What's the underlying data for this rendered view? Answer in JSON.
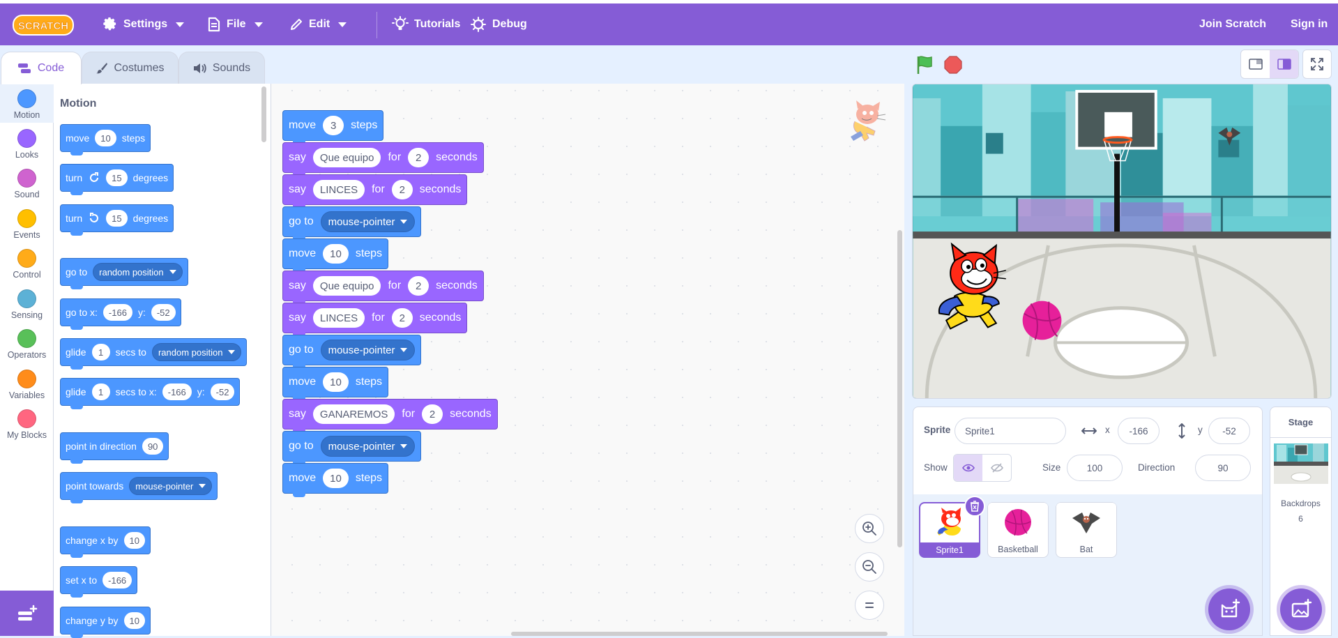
{
  "menubar": {
    "logo_text": "SCRATCH",
    "settings": "Settings",
    "file": "File",
    "edit": "Edit",
    "tutorials": "Tutorials",
    "debug": "Debug",
    "join": "Join Scratch",
    "signin": "Sign in"
  },
  "tabs": {
    "code": "Code",
    "costumes": "Costumes",
    "sounds": "Sounds"
  },
  "categories": [
    {
      "label": "Motion",
      "color": "#4c97ff"
    },
    {
      "label": "Looks",
      "color": "#9966ff"
    },
    {
      "label": "Sound",
      "color": "#cf63cf"
    },
    {
      "label": "Events",
      "color": "#ffbf00"
    },
    {
      "label": "Control",
      "color": "#ffab19"
    },
    {
      "label": "Sensing",
      "color": "#5cb1d6"
    },
    {
      "label": "Operators",
      "color": "#59c059"
    },
    {
      "label": "Variables",
      "color": "#ff8c1a"
    },
    {
      "label": "My Blocks",
      "color": "#ff6680"
    }
  ],
  "palette": {
    "title": "Motion",
    "b1": {
      "a": "move",
      "v": "10",
      "b": "steps"
    },
    "b2": {
      "a": "turn",
      "v": "15",
      "b": "degrees"
    },
    "b3": {
      "a": "turn",
      "v": "15",
      "b": "degrees"
    },
    "b4": {
      "a": "go to",
      "d": "random position"
    },
    "b5": {
      "a": "go to x:",
      "x": "-166",
      "b": "y:",
      "y": "-52"
    },
    "b6": {
      "a": "glide",
      "v": "1",
      "b": "secs to",
      "d": "random position"
    },
    "b7": {
      "a": "glide",
      "v": "1",
      "b": "secs to x:",
      "x": "-166",
      "c": "y:",
      "y": "-52"
    },
    "b8": {
      "a": "point in direction",
      "v": "90"
    },
    "b9": {
      "a": "point towards",
      "d": "mouse-pointer"
    },
    "b10": {
      "a": "change x by",
      "v": "10"
    },
    "b11": {
      "a": "set x to",
      "v": "-166"
    },
    "b12": {
      "a": "change y by",
      "v": "10"
    }
  },
  "script": [
    {
      "type": "move",
      "a": "move",
      "v": "3",
      "b": "steps"
    },
    {
      "type": "say",
      "a": "say",
      "t": "Que equipo",
      "b": "for",
      "v": "2",
      "c": "seconds"
    },
    {
      "type": "say",
      "a": "say",
      "t": "LINCES",
      "b": "for",
      "v": "2",
      "c": "seconds"
    },
    {
      "type": "goto",
      "a": "go to",
      "d": "mouse-pointer"
    },
    {
      "type": "move",
      "a": "move",
      "v": "10",
      "b": "steps"
    },
    {
      "type": "say",
      "a": "say",
      "t": "Que equipo",
      "b": "for",
      "v": "2",
      "c": "seconds"
    },
    {
      "type": "say",
      "a": "say",
      "t": "LINCES",
      "b": "for",
      "v": "2",
      "c": "seconds"
    },
    {
      "type": "goto",
      "a": "go to",
      "d": "mouse-pointer"
    },
    {
      "type": "move",
      "a": "move",
      "v": "10",
      "b": "steps"
    },
    {
      "type": "say",
      "a": "say",
      "t": "GANAREMOS",
      "b": "for",
      "v": "2",
      "c": "seconds"
    },
    {
      "type": "goto",
      "a": "go to",
      "d": "mouse-pointer"
    },
    {
      "type": "move",
      "a": "move",
      "v": "10",
      "b": "steps"
    }
  ],
  "sprite_info": {
    "sprite_label": "Sprite",
    "sprite_name": "Sprite1",
    "x_label": "x",
    "x": "-166",
    "y_label": "y",
    "y": "-52",
    "show_label": "Show",
    "size_label": "Size",
    "size": "100",
    "direction_label": "Direction",
    "direction": "90"
  },
  "sprites": [
    {
      "name": "Sprite1",
      "selected": true
    },
    {
      "name": "Basketball",
      "selected": false
    },
    {
      "name": "Bat",
      "selected": false
    }
  ],
  "stage_panel": {
    "title": "Stage",
    "backdrops_label": "Backdrops",
    "backdrops_count": "6"
  },
  "colors": {
    "accent": "#855cd6",
    "motion": "#4c97ff",
    "looks": "#9966ff"
  }
}
